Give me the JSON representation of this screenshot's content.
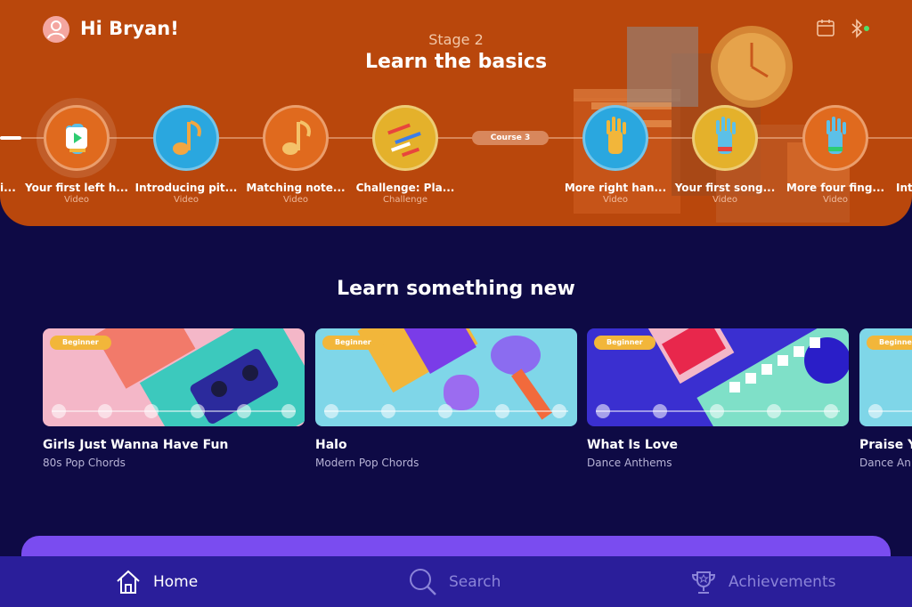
{
  "header": {
    "greeting": "Hi Bryan!",
    "stage_label": "Stage 2",
    "stage_title": "Learn the basics"
  },
  "path": {
    "course_pill": "Course 3",
    "partial_left": "i...",
    "partial_right": "Int",
    "lessons": [
      {
        "title": "Your first left h...",
        "type": "Video",
        "icon": "left-hand-icon",
        "color": "#e06a1e"
      },
      {
        "title": "Introducing pit...",
        "type": "Video",
        "icon": "music-note-icon",
        "color": "#2aa7df"
      },
      {
        "title": "Matching note...",
        "type": "Video",
        "icon": "music-note-icon",
        "color": "#e06a1e"
      },
      {
        "title": "Challenge: Pla...",
        "type": "Challenge",
        "icon": "challenge-icon",
        "color": "#e4b12b"
      },
      {
        "title": "More right han...",
        "type": "Video",
        "icon": "right-hand-icon",
        "color": "#2aa7df"
      },
      {
        "title": "Your first song...",
        "type": "Video",
        "icon": "right-hand-icon",
        "color": "#e4b12b"
      },
      {
        "title": "More four fing...",
        "type": "Video",
        "icon": "right-hand-icon",
        "color": "#e06a1e"
      }
    ]
  },
  "learn": {
    "title": "Learn something new",
    "cards": [
      {
        "badge": "Beginner",
        "title": "Girls Just Wanna Have Fun",
        "subtitle": "80s Pop Chords",
        "bg": "#f4b7c8"
      },
      {
        "badge": "Beginner",
        "title": "Halo",
        "subtitle": "Modern Pop Chords",
        "bg": "#7fd6e8"
      },
      {
        "badge": "Beginner",
        "title": "What Is Love",
        "subtitle": "Dance Anthems",
        "bg": "#3a2fd0"
      },
      {
        "badge": "Beginner",
        "title": "Praise Y",
        "subtitle": "Dance An",
        "bg": "#7fd6e8"
      }
    ]
  },
  "tabs": {
    "home": "Home",
    "search": "Search",
    "achievements": "Achievements"
  },
  "colors": {
    "hero": "#b9470c",
    "background": "#0e0a45",
    "tabbar": "#2a1e9a",
    "promo": "#7a4cf0",
    "badge": "#f2b63a"
  }
}
